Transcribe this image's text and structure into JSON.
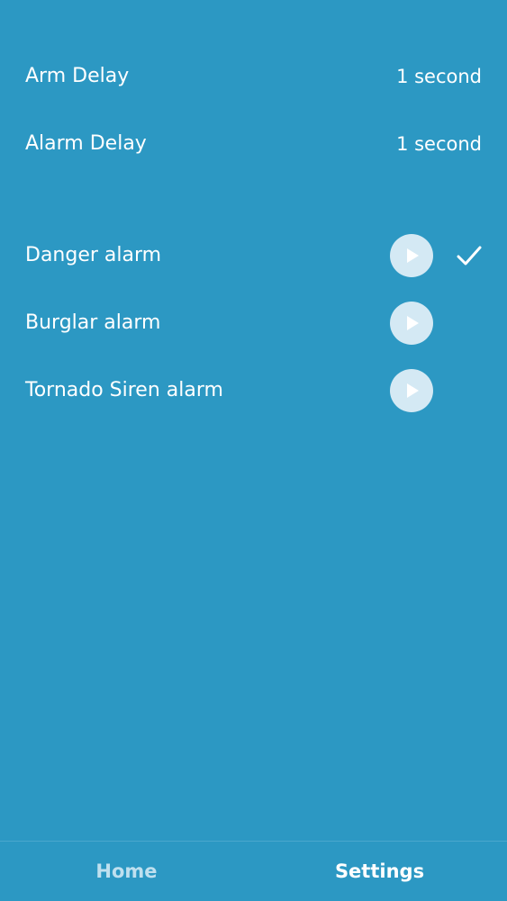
{
  "settings": {
    "delays": [
      {
        "label": "Arm Delay",
        "value": "1 second"
      },
      {
        "label": "Alarm Delay",
        "value": "1 second"
      }
    ],
    "alarms": [
      {
        "label": "Danger alarm",
        "selected": true,
        "play_icon": "play-icon",
        "check_icon": "checkmark-icon"
      },
      {
        "label": "Burglar alarm",
        "selected": false,
        "play_icon": "play-icon"
      },
      {
        "label": "Tornado Siren alarm",
        "selected": false,
        "play_icon": "play-icon"
      }
    ]
  },
  "tabbar": {
    "home_label": "Home",
    "settings_label": "Settings",
    "active": "Settings"
  },
  "colors": {
    "background": "#2c98c3",
    "text": "#ffffff",
    "play_button": "#d4e9f4",
    "inactive_tab": "#bfe0ef"
  }
}
